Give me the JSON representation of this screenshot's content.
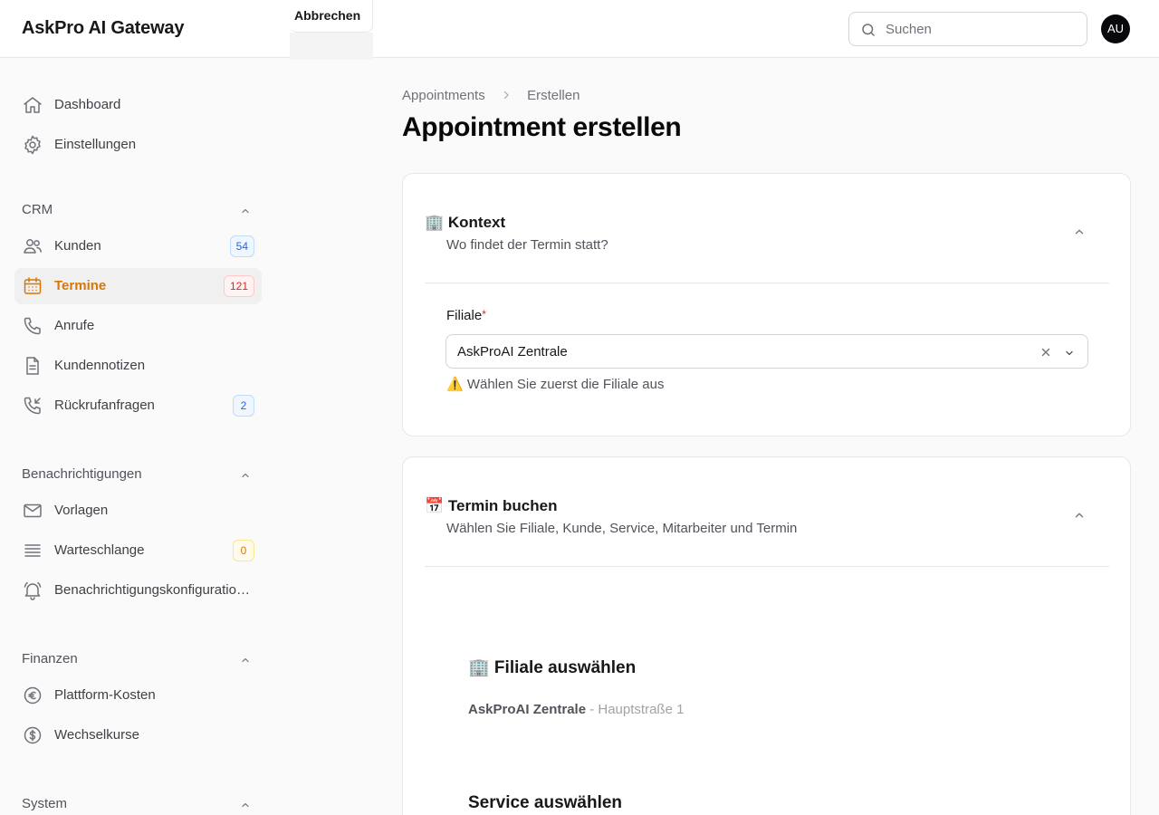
{
  "app": {
    "title": "AskPro AI Gateway"
  },
  "header": {
    "search_placeholder": "Suchen",
    "avatar_initials": "AU",
    "cancel_label": "Abbrechen"
  },
  "sidebar": {
    "top_items": [
      {
        "label": "Dashboard",
        "icon": "home-icon"
      },
      {
        "label": "Einstellungen",
        "icon": "gear-icon"
      }
    ],
    "groups": [
      {
        "label": "CRM",
        "items": [
          {
            "label": "Kunden",
            "icon": "users-icon",
            "badge": "54",
            "badge_color": "#2563eb"
          },
          {
            "label": "Termine",
            "icon": "calendar-icon",
            "badge": "121",
            "badge_color": "#dc2626",
            "active": true
          },
          {
            "label": "Anrufe",
            "icon": "phone-icon"
          },
          {
            "label": "Kundennotizen",
            "icon": "document-icon"
          },
          {
            "label": "Rückrufanfragen",
            "icon": "phone-callback-icon",
            "badge": "2",
            "badge_color": "#2563eb"
          }
        ]
      },
      {
        "label": "Benachrichtigungen",
        "items": [
          {
            "label": "Vorlagen",
            "icon": "envelope-icon"
          },
          {
            "label": "Warteschlange",
            "icon": "queue-icon",
            "badge": "0",
            "badge_color": "#d97706"
          },
          {
            "label": "Benachrichtigungskonfigurationen",
            "icon": "bell-icon"
          }
        ]
      },
      {
        "label": "Finanzen",
        "items": [
          {
            "label": "Plattform-Kosten",
            "icon": "euro-icon"
          },
          {
            "label": "Wechselkurse",
            "icon": "dollar-icon"
          }
        ]
      },
      {
        "label": "System",
        "items": []
      }
    ]
  },
  "breadcrumb": {
    "parent": "Appointments",
    "current": "Erstellen"
  },
  "page": {
    "title": "Appointment erstellen"
  },
  "sections": {
    "context": {
      "title": "🏢 Kontext",
      "subtitle": "Wo findet der Termin statt?",
      "field_label": "Filiale",
      "required_mark": "*",
      "selected_value": "AskProAI Zentrale",
      "hint": "⚠️ Wählen Sie zuerst die Filiale aus"
    },
    "booking": {
      "title": "📅 Termin buchen",
      "subtitle": "Wählen Sie Filiale, Kunde, Service, Mitarbeiter und Termin",
      "branch_heading": "🏢 Filiale auswählen",
      "branch_name": "AskProAI Zentrale",
      "branch_address": " - Hauptstraße 1",
      "service_heading": "Service auswählen"
    }
  },
  "colors": {
    "accent": "#d97706",
    "required": "#dc2626"
  }
}
